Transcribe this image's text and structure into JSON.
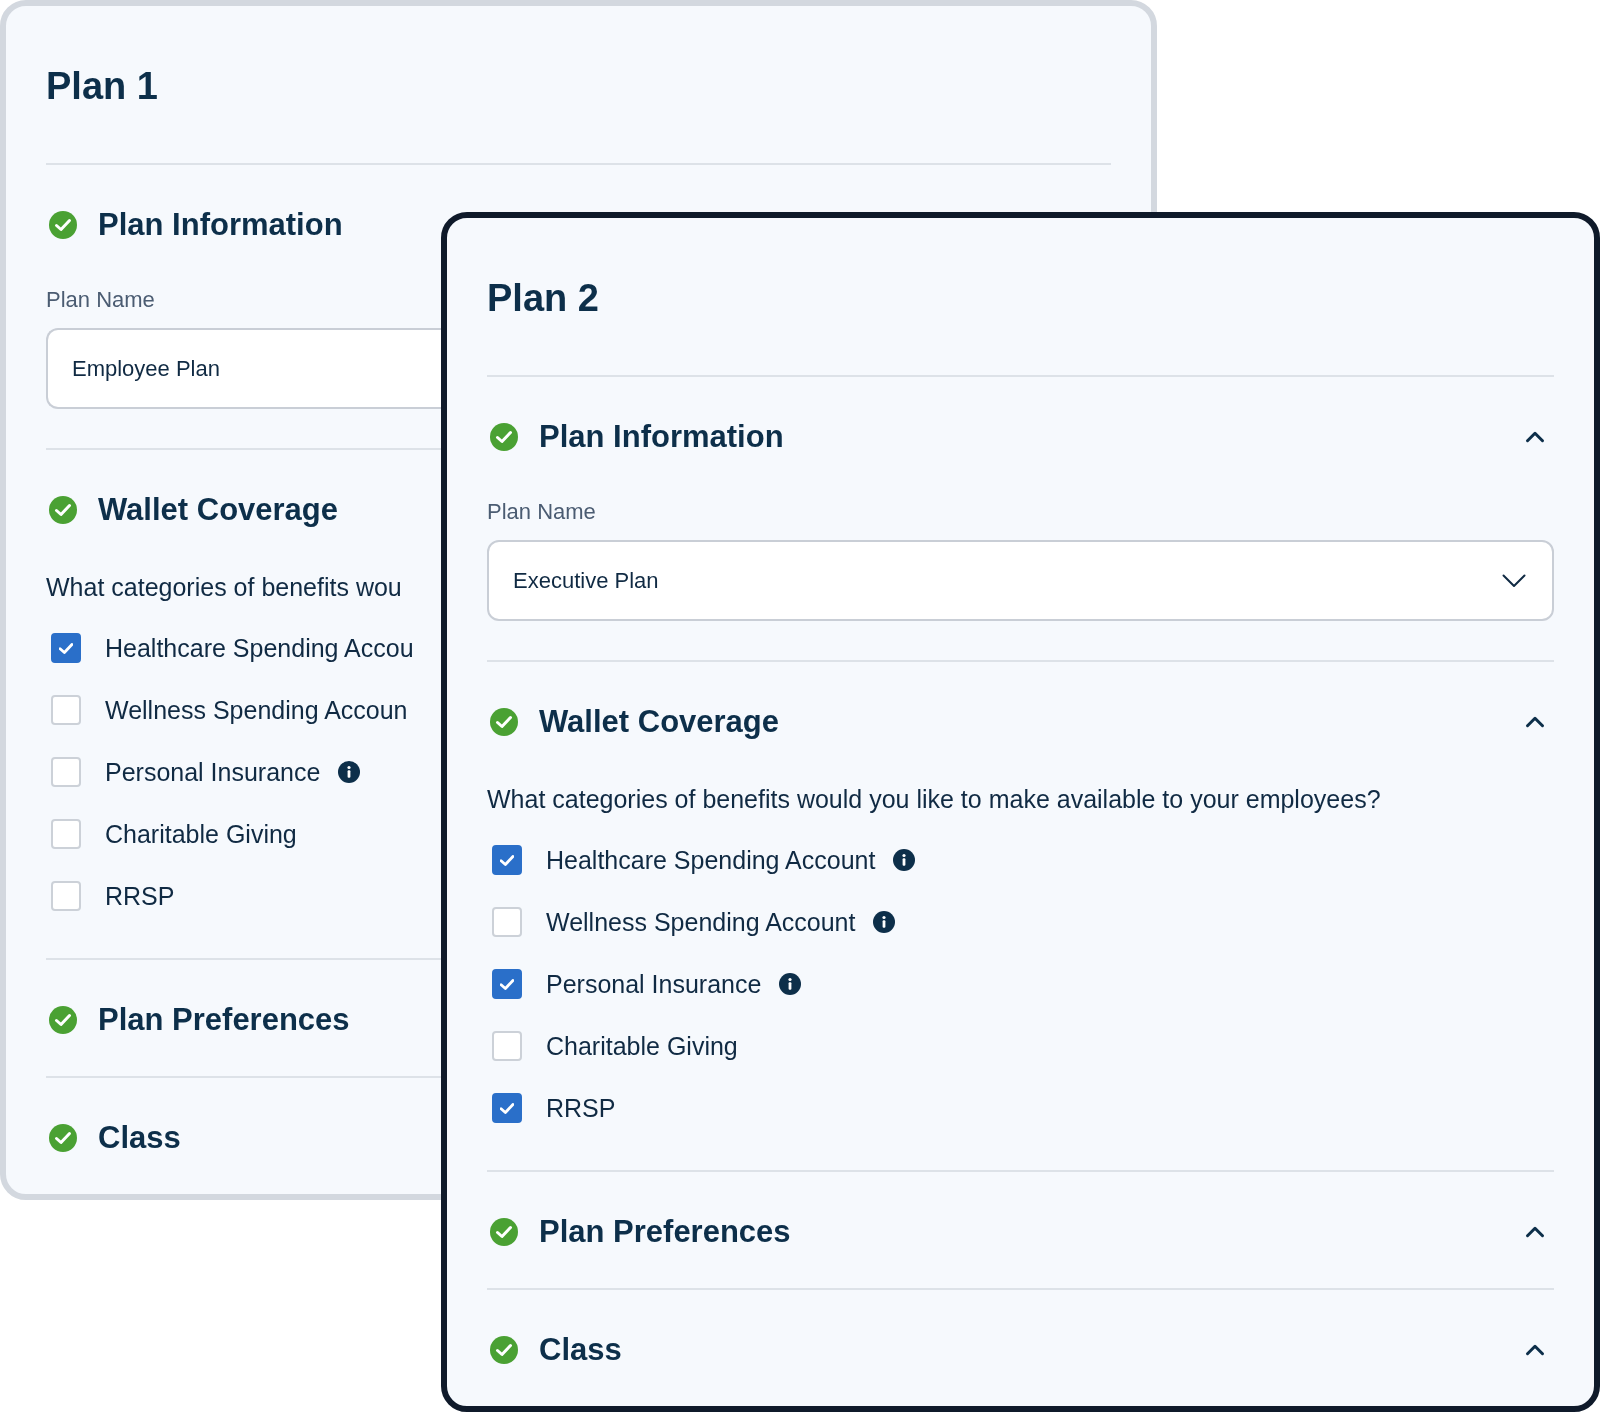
{
  "cards": [
    {
      "title": "Plan 1",
      "sections": [
        {
          "title": "Plan Information",
          "complete": true,
          "field": {
            "label": "Plan Name",
            "kind": "input",
            "value": "Employee Plan"
          }
        },
        {
          "title": "Wallet Coverage",
          "complete": true,
          "question": "What categories of benefits wou",
          "options": [
            {
              "label": "Healthcare Spending Accou",
              "checked": true
            },
            {
              "label": "Wellness Spending Accoun",
              "checked": false
            },
            {
              "label": "Personal Insurance",
              "checked": false,
              "info": true
            },
            {
              "label": "Charitable Giving",
              "checked": false
            },
            {
              "label": "RRSP",
              "checked": false
            }
          ]
        },
        {
          "title": "Plan Preferences",
          "complete": true
        },
        {
          "title": "Class",
          "complete": true
        }
      ]
    },
    {
      "title": "Plan 2",
      "sections": [
        {
          "title": "Plan Information",
          "complete": true,
          "expanded": true,
          "field": {
            "label": "Plan Name",
            "kind": "select",
            "value": "Executive Plan"
          }
        },
        {
          "title": "Wallet Coverage",
          "complete": true,
          "expanded": true,
          "question": "What categories of benefits would you like to make available to your employees?",
          "options": [
            {
              "label": "Healthcare Spending Account",
              "checked": true,
              "info": true
            },
            {
              "label": "Wellness Spending Account",
              "checked": false,
              "info": true
            },
            {
              "label": "Personal Insurance",
              "checked": true,
              "info": true
            },
            {
              "label": "Charitable Giving",
              "checked": false
            },
            {
              "label": "RRSP",
              "checked": true
            }
          ]
        },
        {
          "title": "Plan Preferences",
          "complete": true,
          "expanded": true
        },
        {
          "title": "Class",
          "complete": true,
          "expanded": true
        }
      ]
    }
  ]
}
